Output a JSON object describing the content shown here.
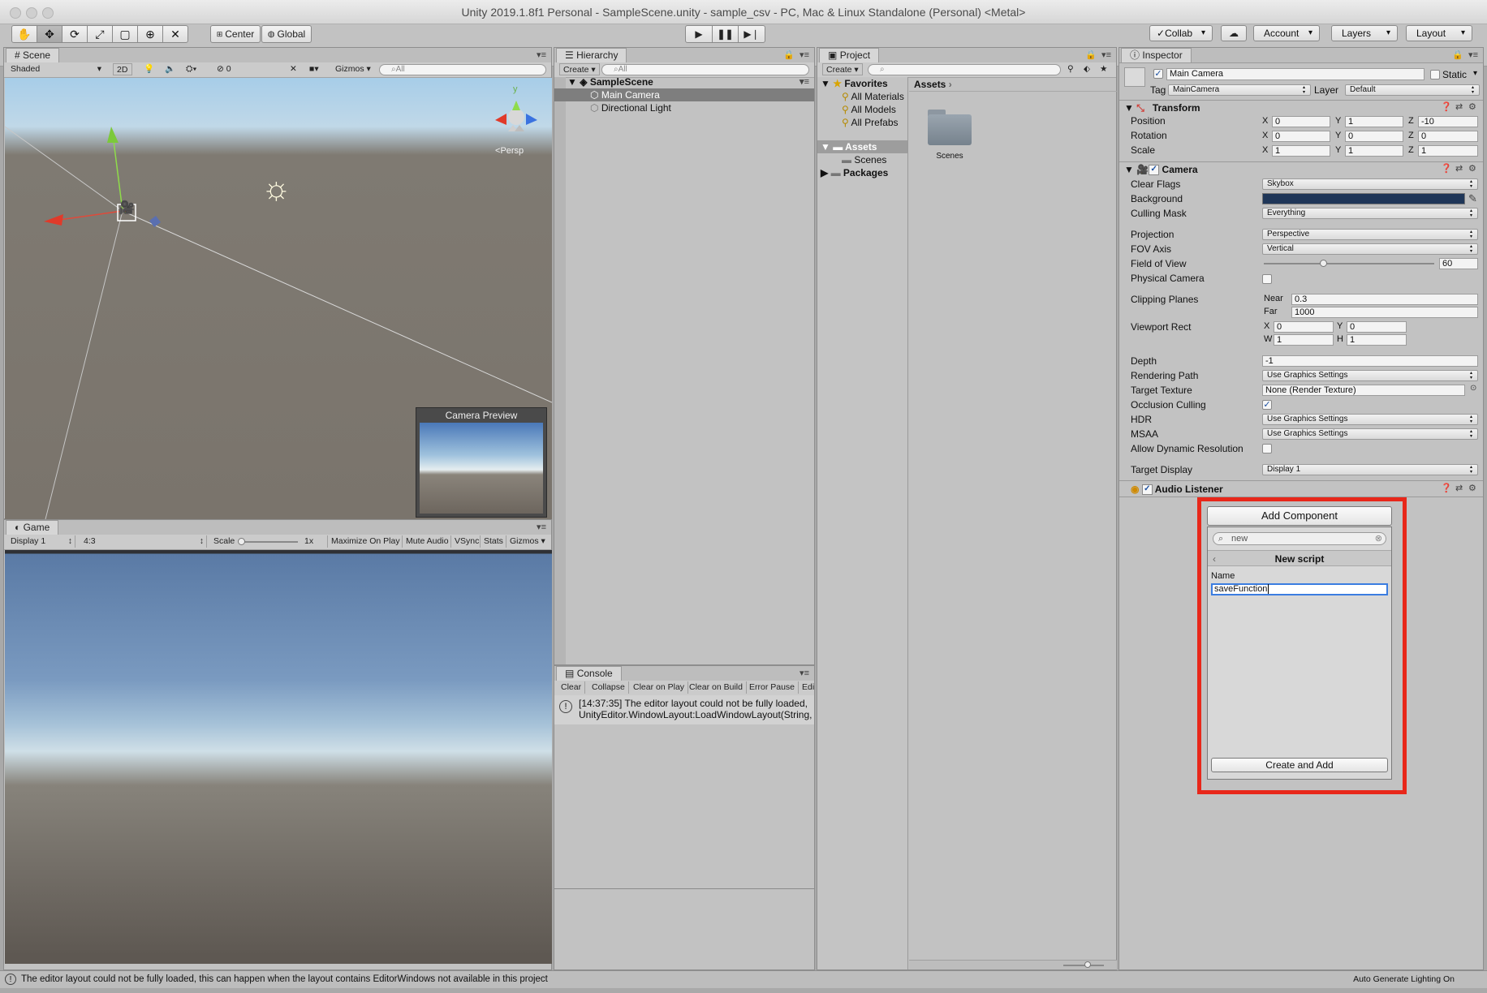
{
  "window": {
    "title": "Unity 2019.1.8f1 Personal - SampleScene.unity - sample_csv - PC, Mac & Linux Standalone (Personal) <Metal>"
  },
  "toolbar": {
    "center_label": "Center",
    "global_label": "Global",
    "collab_label": "Collab",
    "account_label": "Account",
    "layers_label": "Layers",
    "layout_label": "Layout"
  },
  "scene": {
    "tab_label": "Scene",
    "shading_mode": "Shaded",
    "mode_2d": "2D",
    "hidden_count": "0",
    "gizmos_label": "Gizmos",
    "search_placeholder": "All",
    "persp_label": "Persp",
    "gizmo_y": "y",
    "camera_preview_title": "Camera Preview"
  },
  "game": {
    "tab_label": "Game",
    "display": "Display 1",
    "aspect": "4:3",
    "scale_label": "Scale",
    "scale_value": "1x",
    "options": [
      "Maximize On Play",
      "Mute Audio",
      "VSync",
      "Stats",
      "Gizmos"
    ]
  },
  "hierarchy": {
    "tab_label": "Hierarchy",
    "create_label": "Create",
    "search_placeholder": "All",
    "scene_name": "SampleScene",
    "items": [
      "Main Camera",
      "Directional Light"
    ]
  },
  "console": {
    "tab_label": "Console",
    "buttons": [
      "Clear",
      "Collapse",
      "Clear on Play",
      "Clear on Build",
      "Error Pause",
      "Edit"
    ],
    "message_line1": "[14:37:35] The editor layout could not be fully loaded,",
    "message_line2": "UnityEditor.WindowLayout:LoadWindowLayout(String,"
  },
  "project": {
    "tab_label": "Project",
    "create_label": "Create",
    "favorites_label": "Favorites",
    "favorites": [
      "All Materials",
      "All Models",
      "All Prefabs"
    ],
    "assets_label": "Assets",
    "scenes_label": "Scenes",
    "packages_label": "Packages",
    "breadcrumb": "Assets",
    "folder_name": "Scenes"
  },
  "inspector": {
    "tab_label": "Inspector",
    "object_name": "Main Camera",
    "static_label": "Static",
    "tag_label": "Tag",
    "tag_value": "MainCamera",
    "layer_label": "Layer",
    "layer_value": "Default",
    "transform": {
      "title": "Transform",
      "position_label": "Position",
      "position": [
        "0",
        "1",
        "-10"
      ],
      "rotation_label": "Rotation",
      "rotation": [
        "0",
        "0",
        "0"
      ],
      "scale_label": "Scale",
      "scale": [
        "1",
        "1",
        "1"
      ]
    },
    "camera": {
      "title": "Camera",
      "clear_flags_label": "Clear Flags",
      "clear_flags": "Skybox",
      "background_label": "Background",
      "background_color": "#1f3658",
      "culling_mask_label": "Culling Mask",
      "culling_mask": "Everything",
      "projection_label": "Projection",
      "projection": "Perspective",
      "fov_axis_label": "FOV Axis",
      "fov_axis": "Vertical",
      "fov_label": "Field of View",
      "fov": "60",
      "fov_slider_fraction": 0.33,
      "physical_label": "Physical Camera",
      "clipping_label": "Clipping Planes",
      "near_label": "Near",
      "near": "0.3",
      "far_label": "Far",
      "far": "1000",
      "viewport_label": "Viewport Rect",
      "vp_x": "0",
      "vp_y": "0",
      "vp_w": "1",
      "vp_h": "1",
      "depth_label": "Depth",
      "depth": "-1",
      "rendering_path_label": "Rendering Path",
      "rendering_path": "Use Graphics Settings",
      "target_texture_label": "Target Texture",
      "target_texture": "None (Render Texture)",
      "occlusion_label": "Occlusion Culling",
      "hdr_label": "HDR",
      "hdr": "Use Graphics Settings",
      "msaa_label": "MSAA",
      "msaa": "Use Graphics Settings",
      "dynamic_res_label": "Allow Dynamic Resolution",
      "target_display_label": "Target Display",
      "target_display": "Display 1"
    },
    "audio_listener": {
      "title": "Audio Listener"
    },
    "add_component": {
      "button_label": "Add Component",
      "search_value": "new",
      "header": "New script",
      "name_label": "Name",
      "name_value": "saveFunction",
      "create_button": "Create and Add",
      "highlight_color": "#e8271a"
    }
  },
  "statusbar": {
    "message": "The editor layout could not be fully loaded, this can happen when the layout contains EditorWindows not available in this project",
    "right": "Auto Generate Lighting On"
  }
}
